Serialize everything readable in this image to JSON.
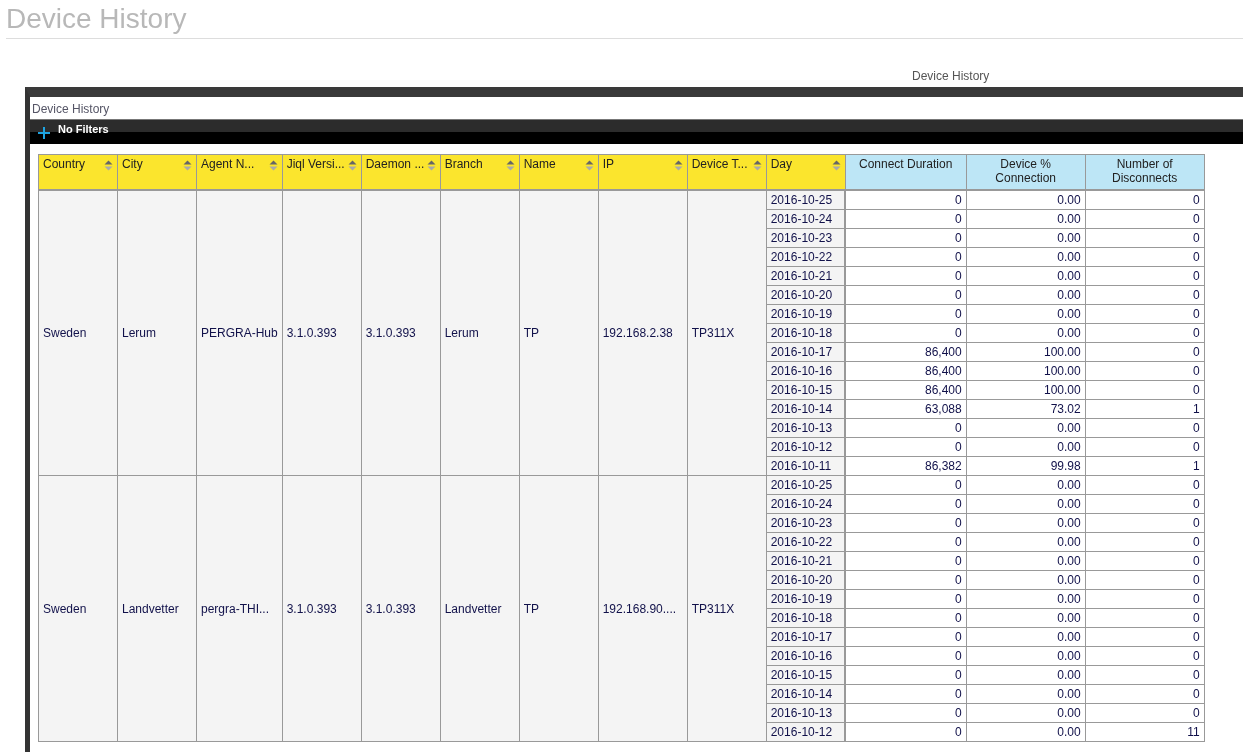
{
  "page_title": "Device History",
  "report_title": "Device History",
  "panel": {
    "title": "Device History",
    "filter_label": "No Filters"
  },
  "table": {
    "columns": [
      {
        "label": "Country",
        "kind": "sortable"
      },
      {
        "label": "City",
        "kind": "sortable"
      },
      {
        "label": "Agent N...",
        "kind": "sortable"
      },
      {
        "label": "Jiql Versi...",
        "kind": "sortable"
      },
      {
        "label": "Daemon ...",
        "kind": "sortable"
      },
      {
        "label": "Branch",
        "kind": "sortable"
      },
      {
        "label": "Name",
        "kind": "sortable"
      },
      {
        "label": "IP",
        "kind": "sortable"
      },
      {
        "label": "Device T...",
        "kind": "sortable"
      },
      {
        "label": "Day",
        "kind": "sortable"
      },
      {
        "label": "Connect Duration",
        "kind": "measure"
      },
      {
        "label": "Device % Connection",
        "kind": "measure"
      },
      {
        "label": "Number of Disconnects",
        "kind": "measure"
      }
    ],
    "groups": [
      {
        "fields": [
          "Sweden",
          "Lerum",
          "PERGRA-Hub",
          "3.1.0.393",
          "3.1.0.393",
          "Lerum",
          "TP",
          "192.168.2.38",
          "TP311X"
        ],
        "rows": [
          [
            "2016-10-25",
            "0",
            "0.00",
            "0"
          ],
          [
            "2016-10-24",
            "0",
            "0.00",
            "0"
          ],
          [
            "2016-10-23",
            "0",
            "0.00",
            "0"
          ],
          [
            "2016-10-22",
            "0",
            "0.00",
            "0"
          ],
          [
            "2016-10-21",
            "0",
            "0.00",
            "0"
          ],
          [
            "2016-10-20",
            "0",
            "0.00",
            "0"
          ],
          [
            "2016-10-19",
            "0",
            "0.00",
            "0"
          ],
          [
            "2016-10-18",
            "0",
            "0.00",
            "0"
          ],
          [
            "2016-10-17",
            "86,400",
            "100.00",
            "0"
          ],
          [
            "2016-10-16",
            "86,400",
            "100.00",
            "0"
          ],
          [
            "2016-10-15",
            "86,400",
            "100.00",
            "0"
          ],
          [
            "2016-10-14",
            "63,088",
            "73.02",
            "1"
          ],
          [
            "2016-10-13",
            "0",
            "0.00",
            "0"
          ],
          [
            "2016-10-12",
            "0",
            "0.00",
            "0"
          ],
          [
            "2016-10-11",
            "86,382",
            "99.98",
            "1"
          ]
        ]
      },
      {
        "fields": [
          "Sweden",
          "Landvetter",
          "pergra-THI...",
          "3.1.0.393",
          "3.1.0.393",
          "Landvetter",
          "TP",
          "192.168.90....",
          "TP311X"
        ],
        "rows": [
          [
            "2016-10-25",
            "0",
            "0.00",
            "0"
          ],
          [
            "2016-10-24",
            "0",
            "0.00",
            "0"
          ],
          [
            "2016-10-23",
            "0",
            "0.00",
            "0"
          ],
          [
            "2016-10-22",
            "0",
            "0.00",
            "0"
          ],
          [
            "2016-10-21",
            "0",
            "0.00",
            "0"
          ],
          [
            "2016-10-20",
            "0",
            "0.00",
            "0"
          ],
          [
            "2016-10-19",
            "0",
            "0.00",
            "0"
          ],
          [
            "2016-10-18",
            "0",
            "0.00",
            "0"
          ],
          [
            "2016-10-17",
            "0",
            "0.00",
            "0"
          ],
          [
            "2016-10-16",
            "0",
            "0.00",
            "0"
          ],
          [
            "2016-10-15",
            "0",
            "0.00",
            "0"
          ],
          [
            "2016-10-14",
            "0",
            "0.00",
            "0"
          ],
          [
            "2016-10-13",
            "0",
            "0.00",
            "0"
          ],
          [
            "2016-10-12",
            "0",
            "0.00",
            "11"
          ]
        ]
      }
    ]
  }
}
